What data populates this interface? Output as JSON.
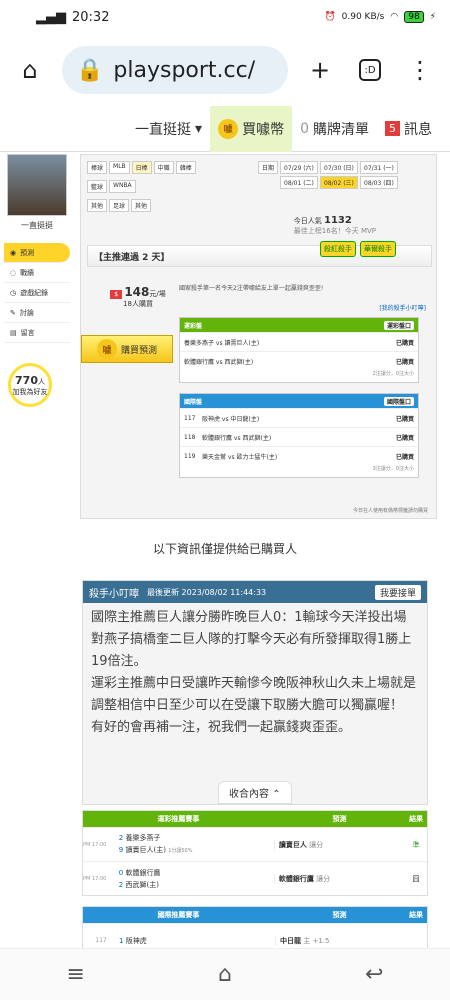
{
  "status": {
    "time": "20:32",
    "net": "0.90 KB/s",
    "battery": "98"
  },
  "browser": {
    "url": "playsport.cc/",
    "tab_count": ":D"
  },
  "topnav": {
    "brand": "一直挺挺",
    "buy": "買噱幣",
    "buy_coin": "噱",
    "cart_count": "0",
    "cart": "購牌清單",
    "msg_count": "5",
    "msg": "訊息"
  },
  "sidebar": {
    "name": "一直挺挺",
    "items": [
      "預測",
      "戰績",
      "遊戲紀錄",
      "討論",
      "留言"
    ],
    "fans": "770",
    "fans_unit": "人",
    "fans_label": "加我為好友"
  },
  "filters": {
    "row1_label": "棒球",
    "row1": [
      "MLB",
      "日棒",
      "中職",
      "韓棒"
    ],
    "row2_label": "籃球",
    "row2": [
      "WNBA"
    ],
    "row3_label": "其他",
    "row3": [
      "足球",
      "其他"
    ]
  },
  "dates": {
    "label": "日期",
    "items": [
      "07/29 (六)",
      "07/30 (日)",
      "07/31 (一)",
      "08/01 (二)",
      "08/02 (三)",
      "08/03 (四)"
    ]
  },
  "popularity": {
    "label": "今日人氣",
    "value": "1132",
    "rank": "最佳上榜16名！今天",
    "rank_tag": "MVP"
  },
  "recommend": {
    "title": "【主推連過 2 天】",
    "stamp1": "殺紅殺手",
    "stamp2": "華爾殺手"
  },
  "buyers": {
    "count": "148",
    "count_label": "元/場",
    "people": "18",
    "people_label": "人購買"
  },
  "buy_btn": "購買預測",
  "rank_note": "國家殺手第一名今天2注帶噱給友上單一起贏錢爽歪歪!",
  "link": "[我的殺手小叮嚀]",
  "table1": {
    "header": "運彩盤",
    "sub": "運彩盤口",
    "rows": [
      {
        "c": "養樂多燕子 vs 讀賣巨人(主)",
        "s": "已購買"
      },
      {
        "c": "軟體銀行鷹 vs 西武獅(主)",
        "s": "已購買"
      }
    ],
    "foot": "2注讓分，0注大小"
  },
  "table2": {
    "header": "國際盤",
    "sub": "國際盤口",
    "rows": [
      {
        "n": "117",
        "c": "阪神虎 vs 中日龍(主)",
        "s": "已購買"
      },
      {
        "n": "118",
        "c": "軟體銀行鷹 vs 西武獅(主)",
        "s": "已購買"
      },
      {
        "n": "119",
        "c": "樂天金鷲 vs 歐力士猛牛(主)",
        "s": "已購買"
      }
    ],
    "foot": "3注讓分，0注大小"
  },
  "footnote": "今日在人使用有偽幣標籤請勿購買",
  "only_buyers": "以下資訊僅提供給已購買人",
  "expert": {
    "title": "殺手小叮嚀",
    "updated": "最後更新 2023/08/02 11:44:33",
    "buy": "我要接單",
    "body": "國際主推薦巨人讓分勝昨晚巨人0：1輸球今天洋投出場對燕子搞橋奎二巨人隊的打擊今天必有所發揮取得1勝上19倍注。\n運彩主推薦中日受讓昨天輸慘今晚阪神秋山久未上場就是調整相信中日至少可以在受讓下取勝大膽可以獨贏喔！\n有好的會再補一注，祝我們一起贏錢爽歪歪。",
    "collapse": "收合內容"
  },
  "pick_table1": {
    "h1": "運彩推薦賽事",
    "h2": "預測",
    "h3": "結果",
    "rows": [
      {
        "time": "PM 17:00",
        "a_n": "2",
        "a": "養樂多燕子",
        "b_n": "9",
        "b": "讀賣巨人(主)",
        "line": "1分讓50%",
        "pick": "讀賣巨人",
        "type": "讓分",
        "res": "準"
      },
      {
        "time": "PM 17:00",
        "a_n": "0",
        "a": "軟體銀行鷹",
        "b_n": "2",
        "b": "西武獅(主)",
        "line": "",
        "pick": "軟體銀行鷹",
        "type": "讓分",
        "res": "囧"
      }
    ]
  },
  "pick_table2": {
    "h1": "國際推薦賽事",
    "h2": "預測",
    "h3": "結果",
    "rows": [
      {
        "time": "117",
        "a_n": "1",
        "a": "阪神虎",
        "pick": "中日龍",
        "type": "主 +1.5"
      }
    ]
  }
}
